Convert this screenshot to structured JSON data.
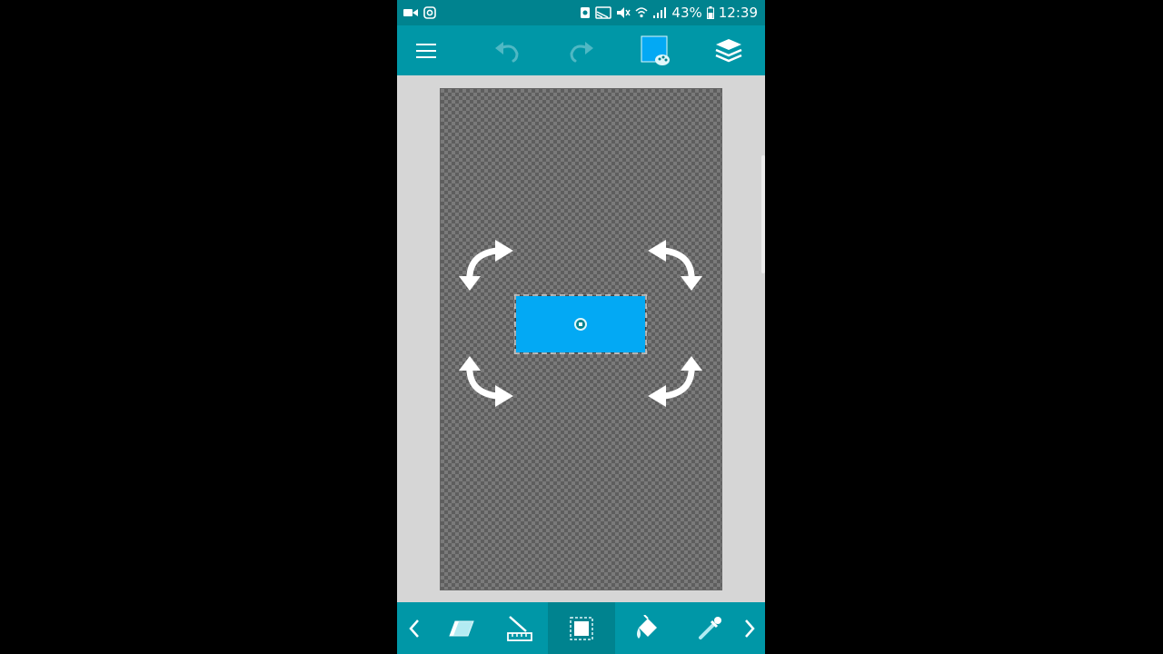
{
  "status_bar": {
    "battery_percent": "43%",
    "time": "12:39"
  },
  "toolbar": {
    "icons": [
      "menu-icon",
      "undo-icon",
      "redo-icon",
      "color-palette-icon",
      "layers-icon"
    ],
    "current_color": "#03a9f4",
    "undo_enabled": false,
    "redo_enabled": false
  },
  "bottom_bar": {
    "tools": [
      "eraser",
      "ruler",
      "selection",
      "fill-bucket",
      "eyedropper"
    ],
    "active_tool": "selection"
  },
  "colors": {
    "primary": "#0097a7",
    "primary_dark": "#00838f",
    "selection_fill": "#03a9f4",
    "canvas_area": "#d6d6d6"
  }
}
